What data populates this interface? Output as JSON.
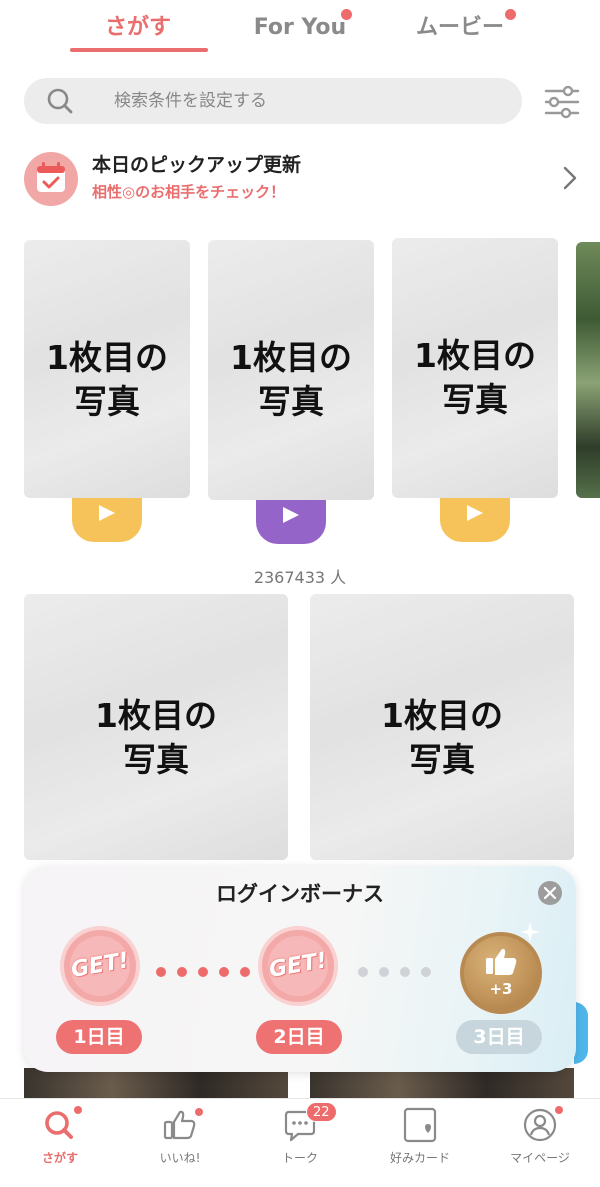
{
  "tabs": [
    {
      "label": "さがす",
      "active": true,
      "dot": false
    },
    {
      "label": "For You",
      "active": false,
      "dot": true
    },
    {
      "label": "ムービー",
      "active": false,
      "dot": true
    }
  ],
  "search": {
    "placeholder": "検索条件を設定する",
    "icon": "search-icon"
  },
  "filter": {
    "icon": "filter-sliders-icon"
  },
  "pickup": {
    "title": "本日のピックアップ更新",
    "subtitle": "相性◎のお相手をチェック！",
    "icon": "calendar-check-icon"
  },
  "carousel": {
    "cards": [
      {
        "label_line1": "1枚目の",
        "label_line2": "写真",
        "play_color": "#f6c25a"
      },
      {
        "label_line1": "1枚目の",
        "label_line2": "写真",
        "play_color": "#9564c9"
      },
      {
        "label_line1": "1枚目の",
        "label_line2": "写真",
        "play_color": "#f6c25a"
      }
    ]
  },
  "result_count": "2367433 人",
  "grid": {
    "cards": [
      {
        "label_line1": "1枚目の",
        "label_line2": "写真"
      },
      {
        "label_line1": "1枚目の",
        "label_line2": "写真"
      }
    ]
  },
  "login_bonus": {
    "title": "ログインボーナス",
    "badge_text": "GET!",
    "days": [
      {
        "label": "1日目",
        "status": "claimed",
        "color": "#ee7272"
      },
      {
        "label": "2日目",
        "status": "claimed",
        "color": "#ee7272"
      },
      {
        "label": "3日目",
        "status": "upcoming",
        "color": "#c7d6dc"
      }
    ],
    "reward_text": "+3",
    "reward_icon": "thumbs-up-icon",
    "claimed_dot_color": "#ee6b6b",
    "pending_dot_color": "#cfd2d6"
  },
  "bottom_nav": [
    {
      "label": "さがす",
      "icon": "search-icon",
      "active": true,
      "dot": true
    },
    {
      "label": "いいね!",
      "icon": "thumbs-up-icon",
      "active": false,
      "dot": true
    },
    {
      "label": "トーク",
      "icon": "chat-bubble-icon",
      "active": false,
      "badge": "22"
    },
    {
      "label": "好みカード",
      "icon": "heart-card-icon",
      "active": false
    },
    {
      "label": "マイページ",
      "icon": "profile-icon",
      "active": false,
      "dot": true
    }
  ],
  "colors": {
    "accent": "#ea6e6e",
    "text": "#222222",
    "muted": "#888888"
  }
}
